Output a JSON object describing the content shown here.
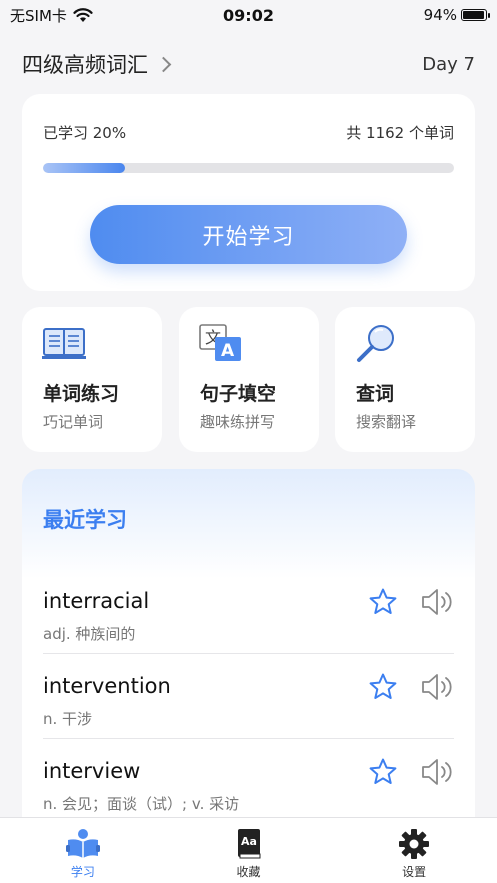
{
  "status_bar": {
    "carrier": "无SIM卡",
    "time": "09:02",
    "battery": "94%",
    "battery_level": 0.94
  },
  "header": {
    "book_title": "四级高频词汇",
    "day": "Day 7"
  },
  "progress": {
    "learned_label": "已学习 20%",
    "learned_fraction": 0.2,
    "total_label": "共 1162 个单词",
    "start_button": "开始学习"
  },
  "features": [
    {
      "title": "单词练习",
      "subtitle": "巧记单词",
      "icon": "book-icon"
    },
    {
      "title": "句子填空",
      "subtitle": "趣味练拼写",
      "icon": "translate-icon"
    },
    {
      "title": "查词",
      "subtitle": "搜索翻译",
      "icon": "magnifier-icon"
    }
  ],
  "recent": {
    "title": "最近学习",
    "words": [
      {
        "word": "interracial",
        "definition": "adj. 种族间的"
      },
      {
        "word": "intervention",
        "definition": "n. 干涉"
      },
      {
        "word": "interview",
        "definition": "n. 会见；面谈（试）; v. 采访"
      }
    ]
  },
  "tabs": [
    {
      "label": "学习",
      "icon": "study-icon",
      "active": true
    },
    {
      "label": "收藏",
      "icon": "dictionary-icon",
      "active": false
    },
    {
      "label": "设置",
      "icon": "gear-icon",
      "active": false
    }
  ],
  "colors": {
    "accent": "#3c7ff0",
    "background": "#f5f5f7",
    "card": "#ffffff"
  }
}
